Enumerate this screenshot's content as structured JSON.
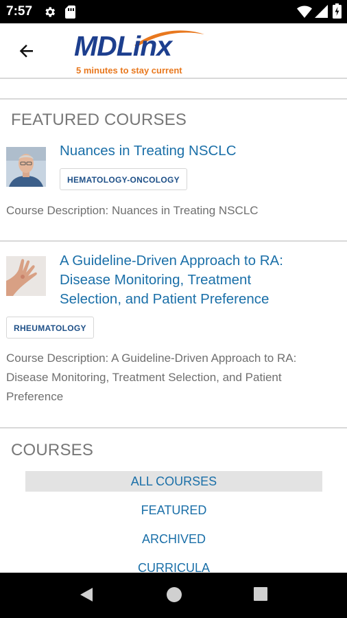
{
  "status_bar": {
    "time": "7:57",
    "icons": [
      "gear-icon",
      "sim-card-icon",
      "wifi-icon",
      "cellular-signal-icon",
      "battery-icon"
    ]
  },
  "app_bar": {
    "back_icon": "arrow-back-icon",
    "logo": {
      "brand": "MDLinx",
      "tagline": "5 minutes to stay current",
      "brand_color": "#1d3f8e",
      "tagline_color": "#e8781e"
    }
  },
  "featured": {
    "heading": "FEATURED COURSES",
    "courses": [
      {
        "title": "Nuances in Treating NSCLC",
        "specialty": "HEMATOLOGY-ONCOLOGY",
        "description": "Course Description: Nuances in Treating NSCLC",
        "thumbnail": "elderly-man-portrait"
      },
      {
        "title_lines": [
          "A Guideline-Driven Approach to RA:",
          "Disease Monitoring, Treatment",
          "Selection, and Patient Preference"
        ],
        "specialty": "RHEUMATOLOGY",
        "description_lines": [
          "Course Description: A Guideline-Driven Approach to RA:",
          "Disease Monitoring, Treatment Selection, and Patient",
          "Preference"
        ],
        "thumbnail": "arthritic-hand"
      }
    ]
  },
  "courses": {
    "heading": "COURSES",
    "tabs": [
      "ALL COURSES",
      "FEATURED",
      "ARCHIVED",
      "CURRICULA"
    ],
    "active_tab": "ALL COURSES"
  },
  "nav_bar": {
    "buttons": [
      "back-triangle-icon",
      "home-circle-icon",
      "recents-square-icon"
    ]
  },
  "colors": {
    "link": "#1a6fa8",
    "badge_text": "#1d4f87",
    "muted": "#777777"
  }
}
